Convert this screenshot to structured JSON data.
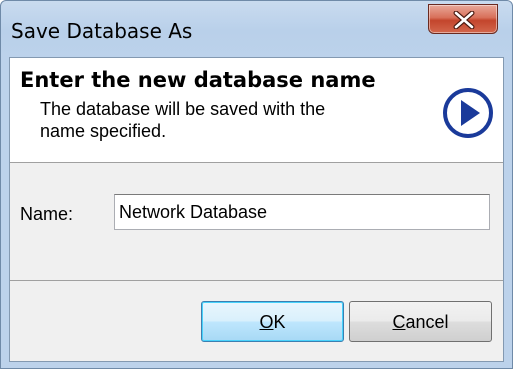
{
  "window": {
    "title": "Save Database As"
  },
  "header": {
    "title": "Enter the new database name",
    "description": "The database will be saved with the name specified."
  },
  "form": {
    "name_label": "Name:",
    "name_value": "Network Database"
  },
  "buttons": {
    "ok_mnemonic": "O",
    "ok_rest": "K",
    "cancel_mnemonic": "C",
    "cancel_rest": "ancel"
  },
  "colors": {
    "arrow_icon": "#1a3a9a",
    "close_button": "#c3452c"
  },
  "icons": {
    "close": "close-x-icon",
    "next": "next-arrow-icon"
  }
}
